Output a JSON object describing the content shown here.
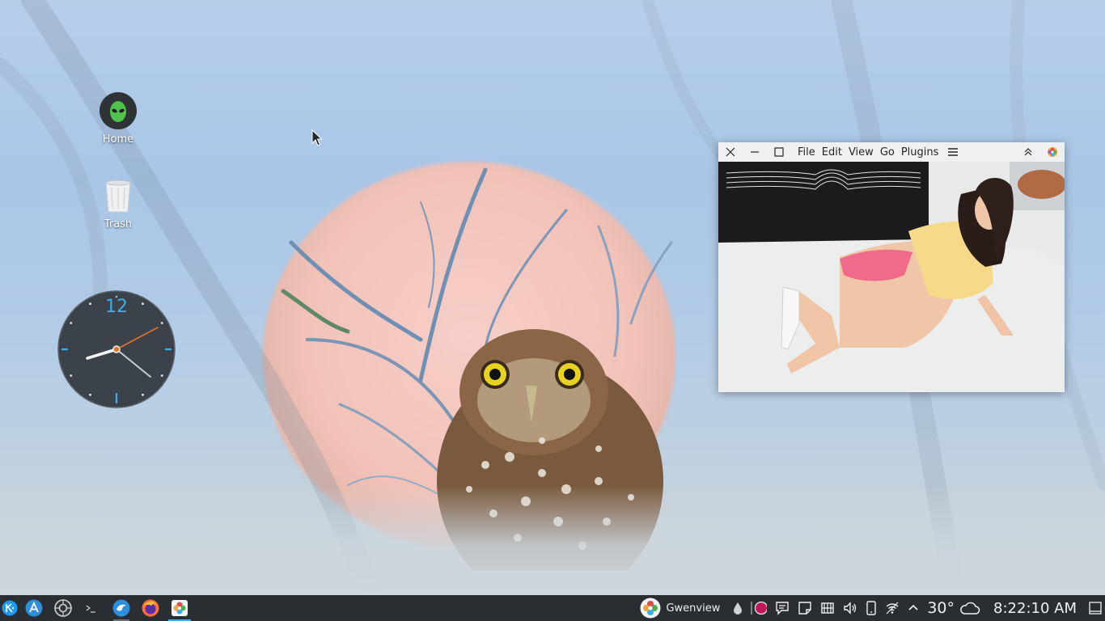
{
  "desktop": {
    "icons": [
      {
        "label": "Home",
        "icon": "alien-home-icon"
      },
      {
        "label": "Trash",
        "icon": "trash-bin-icon"
      }
    ],
    "clock_widget": {
      "numeral": "12",
      "hour_hand_time": "8:22:10 AM"
    }
  },
  "window": {
    "app": "Gwenview",
    "menu": [
      "File",
      "Edit",
      "View",
      "Go",
      "Plugins"
    ],
    "buttons": [
      "close-icon",
      "minimize-icon",
      "maximize-icon",
      "hamburger-menu-icon",
      "collapse-icon",
      "gwenview-app-icon"
    ]
  },
  "taskbar": {
    "launchers": [
      {
        "name": "application-launcher",
        "icon": "kde-logo-icon"
      },
      {
        "name": "discover",
        "icon": "store-icon"
      },
      {
        "name": "system-settings",
        "icon": "settings-icon"
      },
      {
        "name": "konsole",
        "icon": "terminal-icon"
      },
      {
        "name": "dolphin",
        "icon": "file-manager-icon"
      },
      {
        "name": "firefox",
        "icon": "firefox-icon"
      },
      {
        "name": "gwenview",
        "icon": "gwenview-icon"
      }
    ],
    "active_task": "Gwenview",
    "tray": {
      "temperature": "30°",
      "weather_icon": "cloud-icon",
      "time": "8:22:10 AM"
    }
  },
  "colors": {
    "accent": "#3daee9",
    "panel": "#2a2e32",
    "window_bg": "#eff0f1"
  }
}
